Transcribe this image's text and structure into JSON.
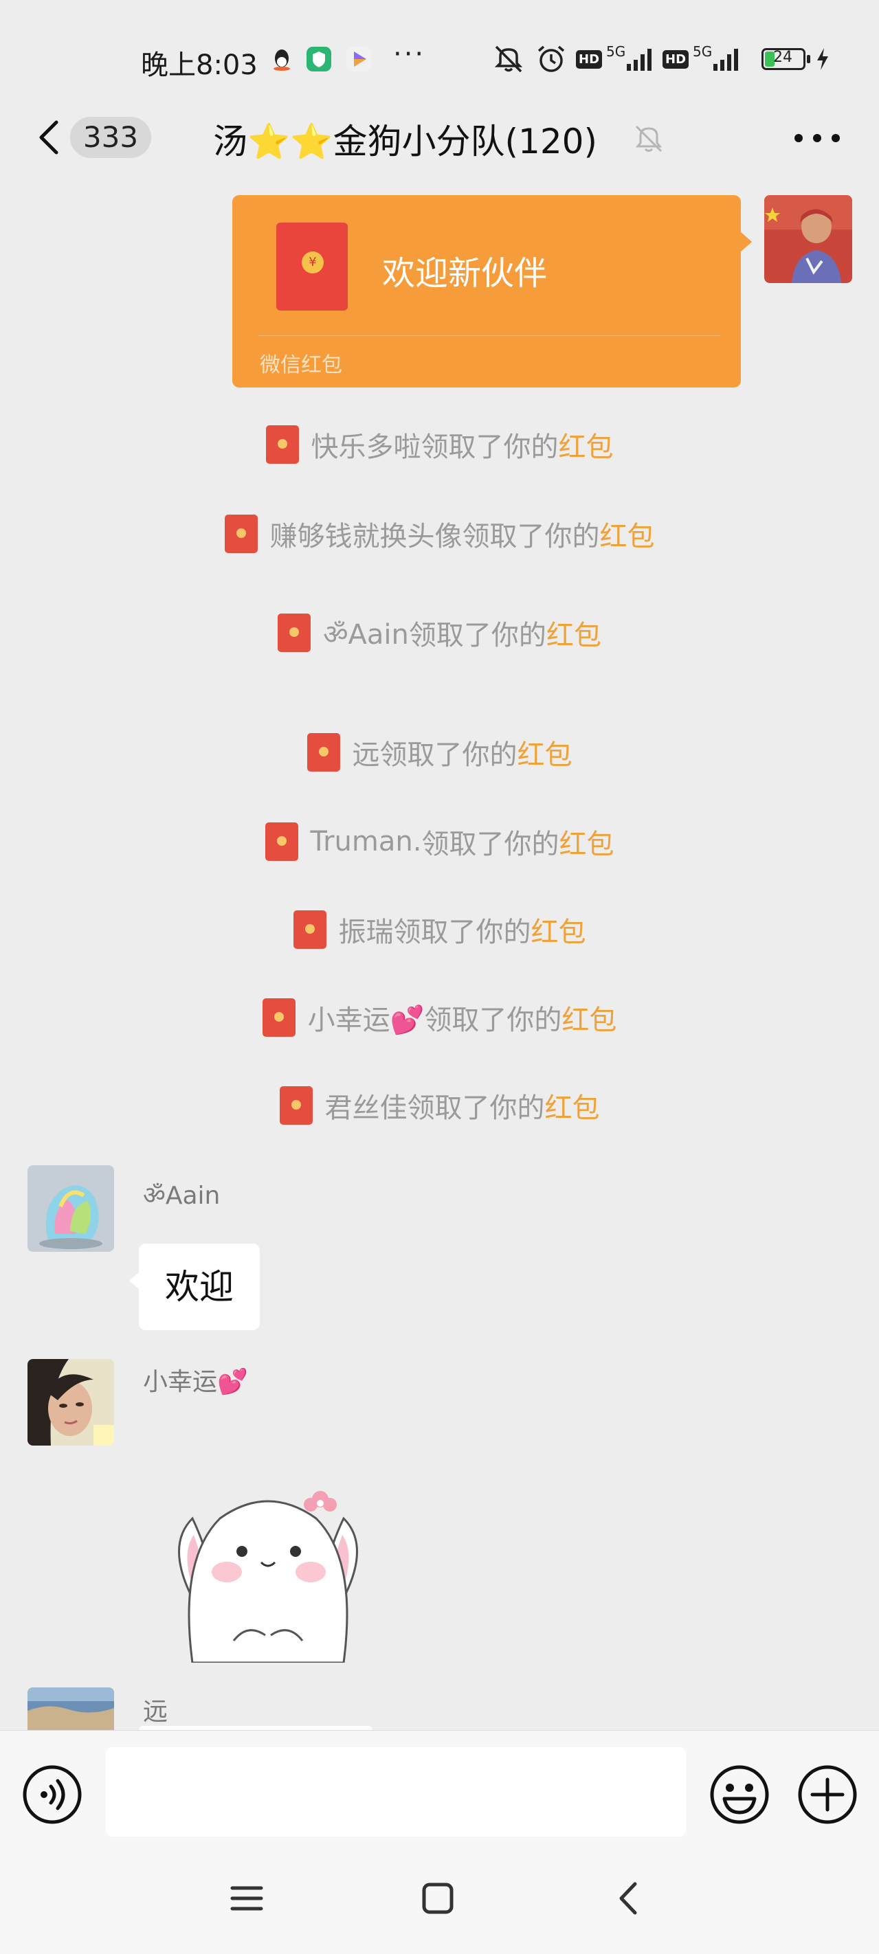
{
  "status_bar": {
    "time": "晚上8:03",
    "dots": "···",
    "network_1": "5G",
    "network_2": "5G",
    "hd_1": "HD",
    "hd_2": "HD",
    "battery": "24"
  },
  "nav": {
    "unread_count": "333",
    "title": "汤⭐⭐金狗小分队(120)"
  },
  "red_packet": {
    "title": "欢迎新伙伴",
    "footer": "微信红包",
    "coin": "¥"
  },
  "notices": [
    {
      "name": "快乐多啦",
      "suffix": "领取了你的",
      "link": "红包"
    },
    {
      "name": "赚够钱就换头像",
      "suffix": "领取了你的",
      "link": "红包"
    },
    {
      "name": "ॐAain",
      "suffix": "领取了你的",
      "link": "红包"
    },
    {
      "name": "远",
      "suffix": "领取了你的",
      "link": "红包"
    },
    {
      "name": "Truman.",
      "suffix": "领取了你的",
      "link": "红包"
    },
    {
      "name": "振瑞",
      "suffix": "领取了你的",
      "link": "红包"
    },
    {
      "name": "小幸运💕",
      "suffix": "领取了你的",
      "link": "红包"
    },
    {
      "name": "君丝佳",
      "suffix": "领取了你的",
      "link": "红包"
    }
  ],
  "messages": [
    {
      "sender": "ॐAain",
      "text": "欢迎"
    },
    {
      "sender": "小幸运💕"
    },
    {
      "sender": "远"
    }
  ],
  "input": {
    "placeholder": ""
  },
  "colors": {
    "background": "#ededed",
    "red_packet": "#f79c3a",
    "link": "#f0a23a",
    "envelope": "#e54d3f"
  },
  "icons": [
    "back-icon",
    "mute-bell-icon",
    "more-icon",
    "voice-icon",
    "emoji-icon",
    "plus-icon",
    "menu-icon",
    "home-icon",
    "nav-back-icon"
  ]
}
